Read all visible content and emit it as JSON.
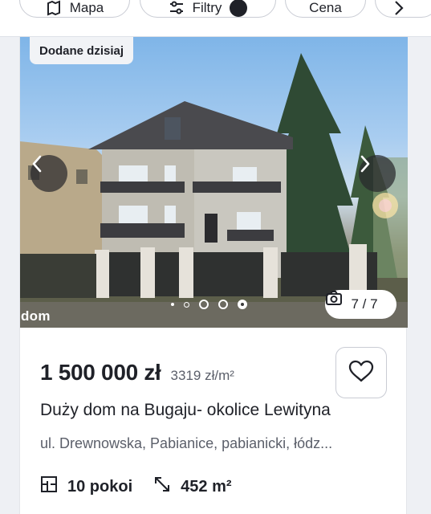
{
  "filters": {
    "map_label": "Mapa",
    "filters_label": "Filtry",
    "price_label": "Cena"
  },
  "listing": {
    "badge": "Dodane dzisiaj",
    "watermark": "dom",
    "photo_counter": "7 / 7",
    "carousel": {
      "total": 5,
      "active": 5
    },
    "price": "1 500 000 zł",
    "price_per_m2": "3319 zł/m²",
    "title": "Duży dom na Bugaju- okolice Lewityna",
    "address": "ul. Drewnowska, Pabianice, pabianicki, łódz...",
    "rooms": "10 pokoi",
    "area": "452 m²"
  },
  "icons": [
    "map-icon",
    "filters-icon",
    "chevron-right-icon",
    "chevron-left-icon",
    "camera-icon",
    "heart-icon",
    "floorplan-icon",
    "resize-arrows-icon"
  ],
  "colors": {
    "text": "#1f2128",
    "muted": "#5b5f6a",
    "border": "#c9ccd4",
    "background": "#eef0f4"
  }
}
